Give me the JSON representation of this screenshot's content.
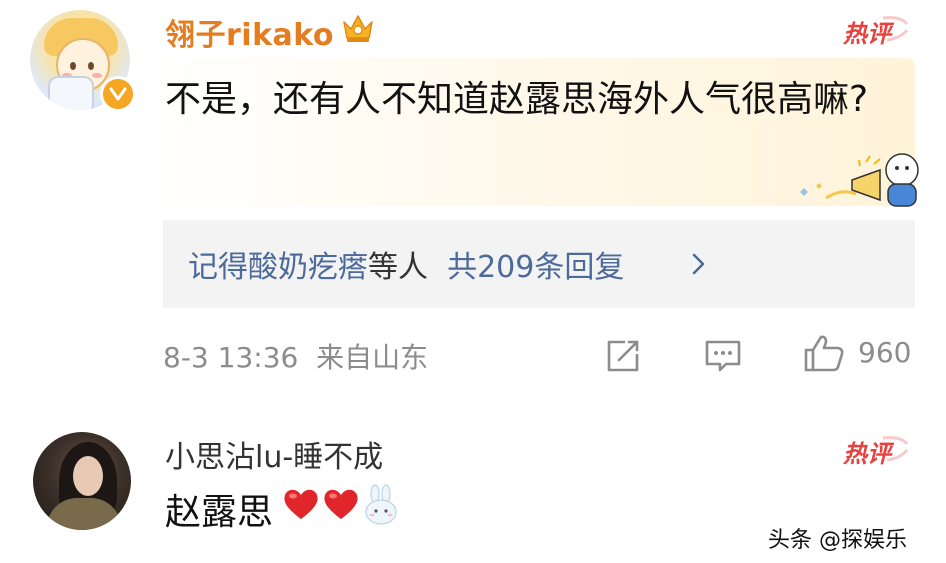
{
  "comment1": {
    "username": "翎子rikako",
    "badge": "crown-icon",
    "hot_label": "热评",
    "text": "不是，还有人不知道赵露思海外人气很高嘛?",
    "replies": {
      "names": "记得酸奶疙瘩",
      "suffix": "等人",
      "count_text": "共209条回复",
      "chevron": "›"
    },
    "date_time": "8-3 13:36",
    "location": "来自山东",
    "likes": "960"
  },
  "comment2": {
    "username": "小思沾lu-睡不成",
    "hot_label": "热评",
    "text": "赵露思"
  },
  "watermark": "头条 @探娱乐",
  "colors": {
    "username_orange": "#e47d1f",
    "link_blue": "#4c6a9a",
    "hot_red": "#e8423f",
    "meta_gray": "#8c8c8c",
    "reply_bg": "#f3f3f3",
    "heart_red": "#e0262b"
  }
}
